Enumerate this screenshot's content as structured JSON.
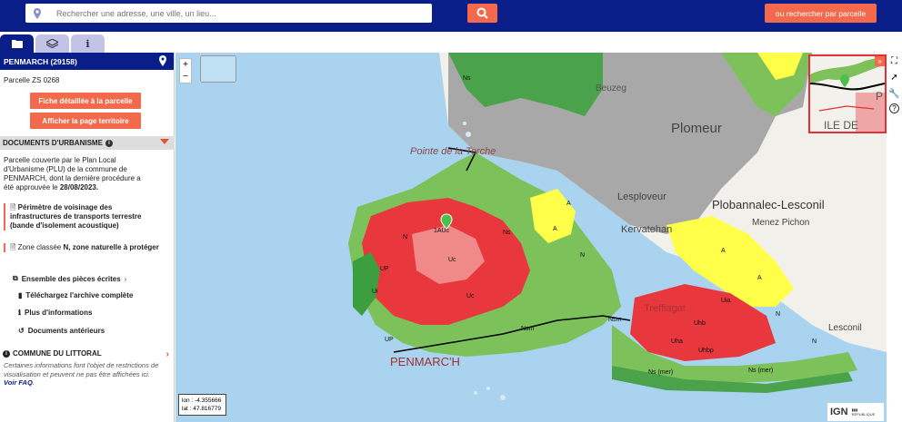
{
  "search": {
    "placeholder": "Rechercher une adresse, une ville, un lieu...",
    "parcel_button": "ou rechercher par parcelle"
  },
  "tabs": [
    {
      "icon": "folder-icon"
    },
    {
      "icon": "layers-icon"
    },
    {
      "icon": "info-icon"
    }
  ],
  "panel": {
    "commune": "PENMARCH (29158)",
    "parcelle": "Parcelle ZS 0268",
    "btn_fiche": "Fiche détaillée à la parcelle",
    "btn_territoire": "Afficher la page territoire",
    "section_title": "DOCUMENTS D'URBANISME",
    "plu_text": "Parcelle couverte par le Plan Local d'Urbanisme (PLU) de la commune de PENMARCH, dont la dernière procédure a été approuvée le",
    "plu_date": "28/08/2023.",
    "item1": "Périmètre de voisinage des infrastructures de transports terrestre (bande d'isolement acoustique)",
    "item2_prefix": "Zone classée",
    "item2_bold": "N, zone naturelle à protéger",
    "link_pieces": "Ensemble des pièces écrites",
    "link_archive": "Téléchargez l'archive complète",
    "link_info": "Plus d'informations",
    "link_docs": "Documents antérieurs",
    "littoral": "COMMUNE DU LITTORAL",
    "notice": "Certaines informations font l'objet de restrictions de visualisation et peuvent ne pas être affichées ici.",
    "faq": "Voir FAQ"
  },
  "map": {
    "places": [
      "Beuzeg",
      "Plomeur",
      "Pointe de la Torche",
      "Lesploveur",
      "Kervatehan",
      "Plobannalec-Lesconil",
      "Menez Pichon",
      "Treffiagat",
      "PENMARC'H",
      "Lesconil",
      "ILE DE"
    ],
    "zone_labels": [
      "N",
      "Ns",
      "A",
      "Uc",
      "Ui",
      "UP",
      "Nsm",
      "Uhb",
      "Uha",
      "Uhbp",
      "Ns (mer)",
      "1AUc",
      "Nm",
      "Uia"
    ],
    "coords": {
      "lon": "lon : -4.355666",
      "lat": "lat : 47.816779"
    },
    "attribution": "IGN",
    "colors": {
      "N": "#7dc15a",
      "A": "#ffff4a",
      "U": "#e8383e",
      "Ns": "#3d9e3f",
      "sea": "#a9d3ee",
      "grey": "#a0a0a0"
    }
  }
}
